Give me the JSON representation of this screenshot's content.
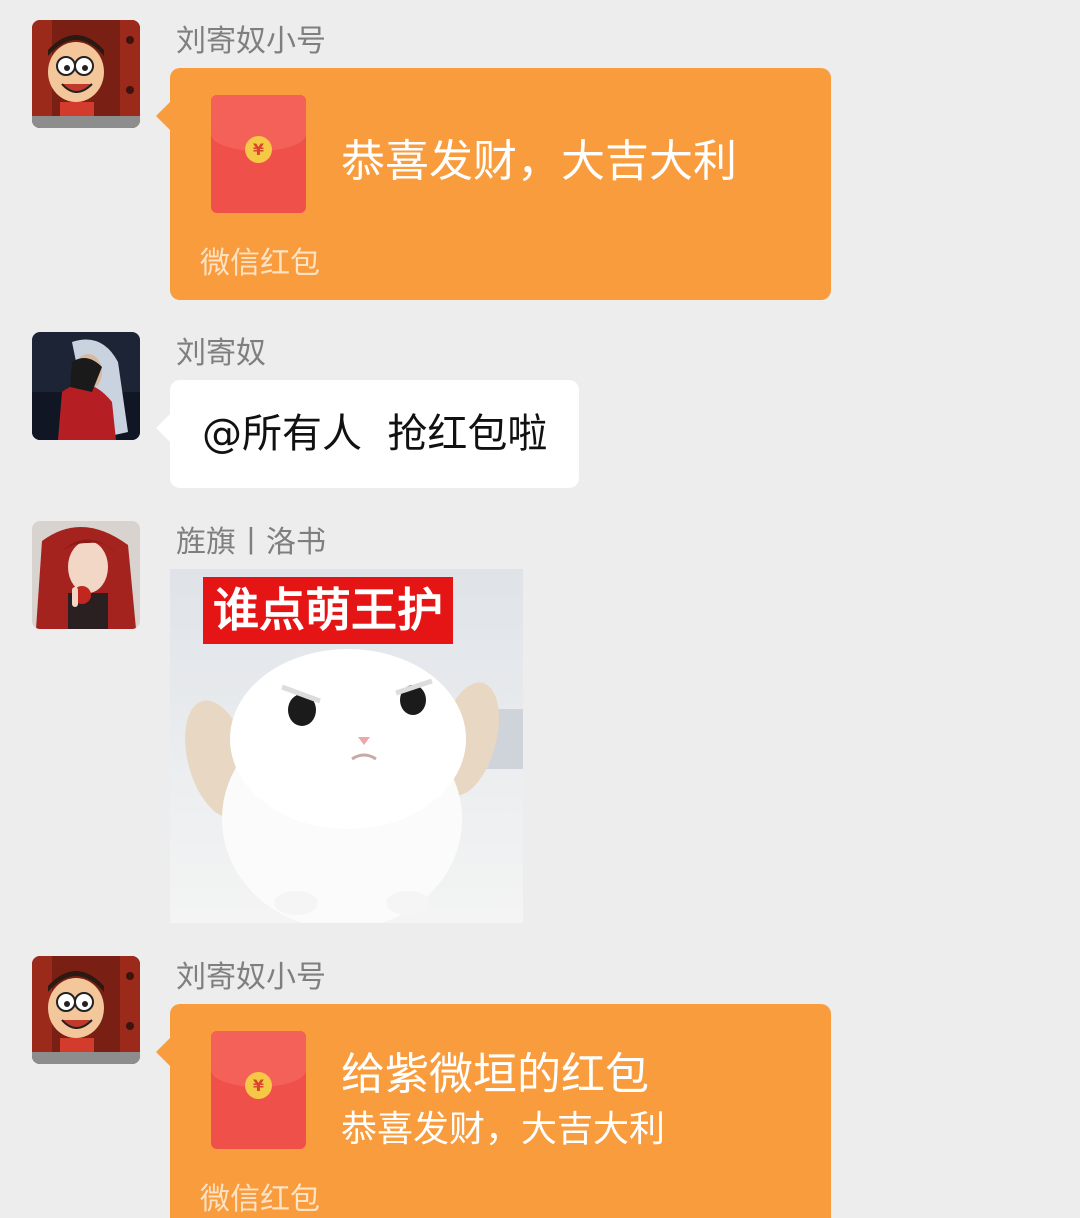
{
  "messages": [
    {
      "type": "red_packet",
      "sender": "刘寄奴小号",
      "title": "恭喜发财，大吉大利",
      "footer": "微信红包",
      "coin_symbol": "¥"
    },
    {
      "type": "text",
      "sender": "刘寄奴",
      "text": "@所有人  抢红包啦"
    },
    {
      "type": "sticker",
      "sender": "旌旗丨洛书",
      "caption": "谁点萌王护"
    },
    {
      "type": "red_packet",
      "sender": "刘寄奴小号",
      "title": "给紫微垣的红包",
      "subtitle": "恭喜发财，大吉大利",
      "footer": "微信红包",
      "coin_symbol": "¥"
    }
  ],
  "colors": {
    "background": "#ededed",
    "red_packet_bubble": "#f89c3e",
    "envelope": "#ef5049",
    "text_bubble": "#ffffff",
    "sender_name": "#7f7f7f",
    "sticker_caption_bg": "#e61515"
  }
}
